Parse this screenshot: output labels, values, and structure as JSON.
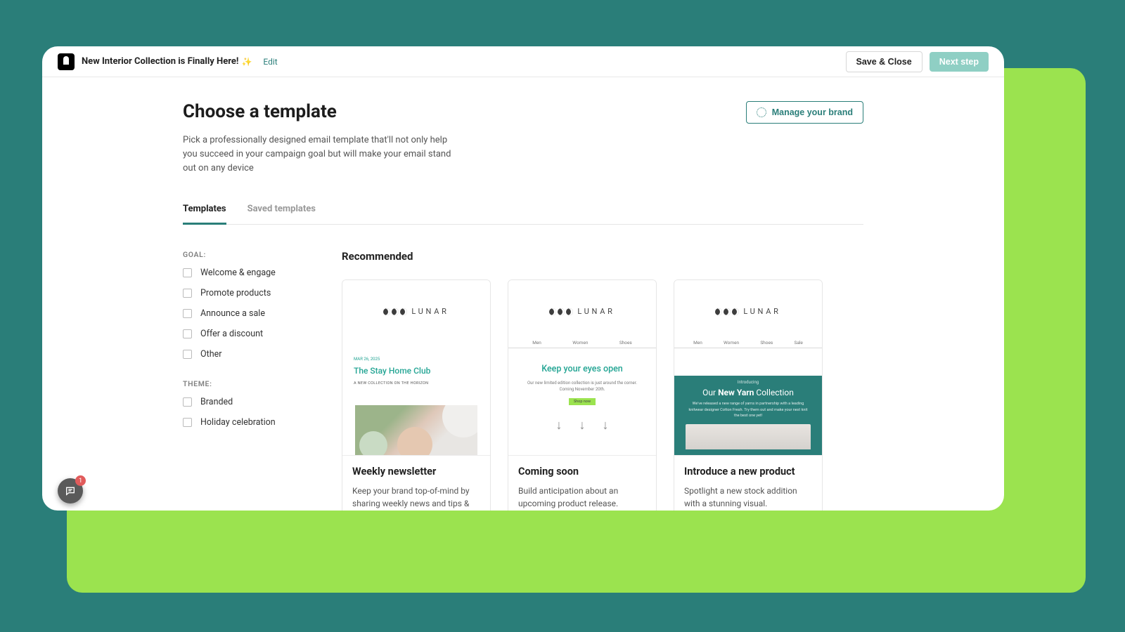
{
  "header": {
    "doc_title": "New Interior Collection is Finally Here!",
    "sparkle": "✨",
    "edit_label": "Edit",
    "save_close_label": "Save & Close",
    "next_step_label": "Next step"
  },
  "page": {
    "title": "Choose a template",
    "subtitle": "Pick a professionally designed email template that'll not only help you succeed in your campaign goal but will make your email stand out on any device",
    "brand_button": "Manage your brand"
  },
  "tabs": {
    "templates": "Templates",
    "saved": "Saved templates"
  },
  "filters": {
    "goal_heading": "GOAL:",
    "theme_heading": "THEME:",
    "goals": [
      "Welcome & engage",
      "Promote products",
      "Announce a sale",
      "Offer a discount",
      "Other"
    ],
    "themes": [
      "Branded",
      "Holiday celebration"
    ]
  },
  "results": {
    "heading": "Recommended",
    "cards": [
      {
        "title": "Weekly newsletter",
        "desc": "Keep your brand top-of-mind by sharing weekly news and tips & tricks.",
        "preview": {
          "brand": "LUNAR",
          "date": "MAR 26, 2025",
          "headline": "The Stay Home Club",
          "tag": "A NEW COLLECTION ON THE HORIZON"
        }
      },
      {
        "title": "Coming soon",
        "desc": "Build anticipation about an upcoming product release.",
        "preview": {
          "brand": "LUNAR",
          "nav": [
            "Men",
            "Women",
            "Shoes"
          ],
          "headline": "Keep your eyes open",
          "sub": "Our new limited edition collection is just around the corner. Coming November 20th.",
          "cta": "Shop now"
        }
      },
      {
        "title": "Introduce a new product",
        "desc": "Spotlight a new stock addition with a stunning visual.",
        "preview": {
          "brand": "LUNAR",
          "nav": [
            "Men",
            "Women",
            "Shoes",
            "Sale"
          ],
          "intro": "Introducing",
          "headline_pre": "Our ",
          "headline_bold": "New Yarn",
          "headline_post": " Collection",
          "desc": "We've released a new range of yarns in partnership with a leading knitwear designer Cotton Fresh. Try them out and make your next knit the best one yet!"
        }
      }
    ]
  },
  "chat": {
    "badge": "1"
  },
  "colors": {
    "accent": "#2a7e79",
    "primary_btn": "#8fcfc4",
    "green_bg": "#9be34f"
  }
}
